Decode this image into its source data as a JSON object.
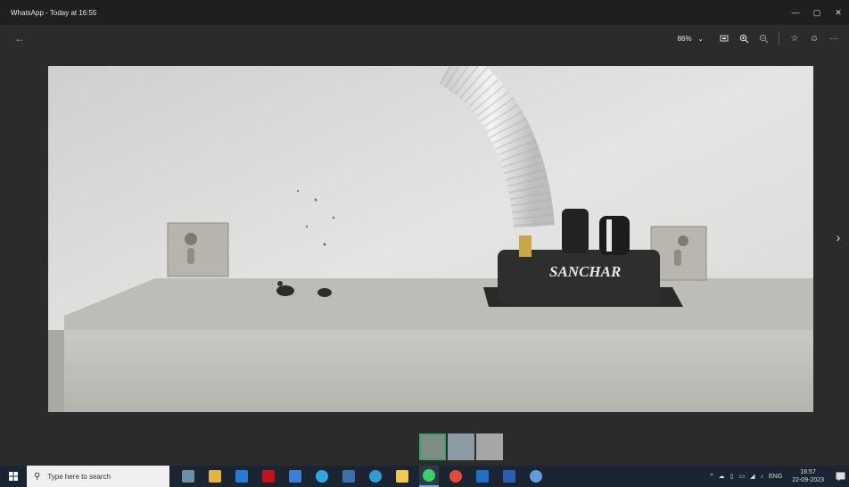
{
  "window": {
    "title": "WhatsApp - Today at 16:55"
  },
  "toolbar": {
    "zoom": "86%",
    "zoom_caret": "⌄"
  },
  "photo": {
    "brand_label": "SANCHAR"
  },
  "taskbar": {
    "search_placeholder": "Type here to search",
    "language": "ENG",
    "time": "16:57",
    "date": "22-09-2023"
  },
  "colors": {
    "titlebar": "#1f1f1f",
    "viewer": "#2b2b2b",
    "taskbar": "#1b2531",
    "thumb_selected": "#3aa26a"
  },
  "icons": [
    "back-arrow-icon",
    "fit-icon",
    "zoom-in-icon",
    "zoom-out-icon",
    "star-icon",
    "emoji-icon",
    "more-icon",
    "next-icon"
  ]
}
